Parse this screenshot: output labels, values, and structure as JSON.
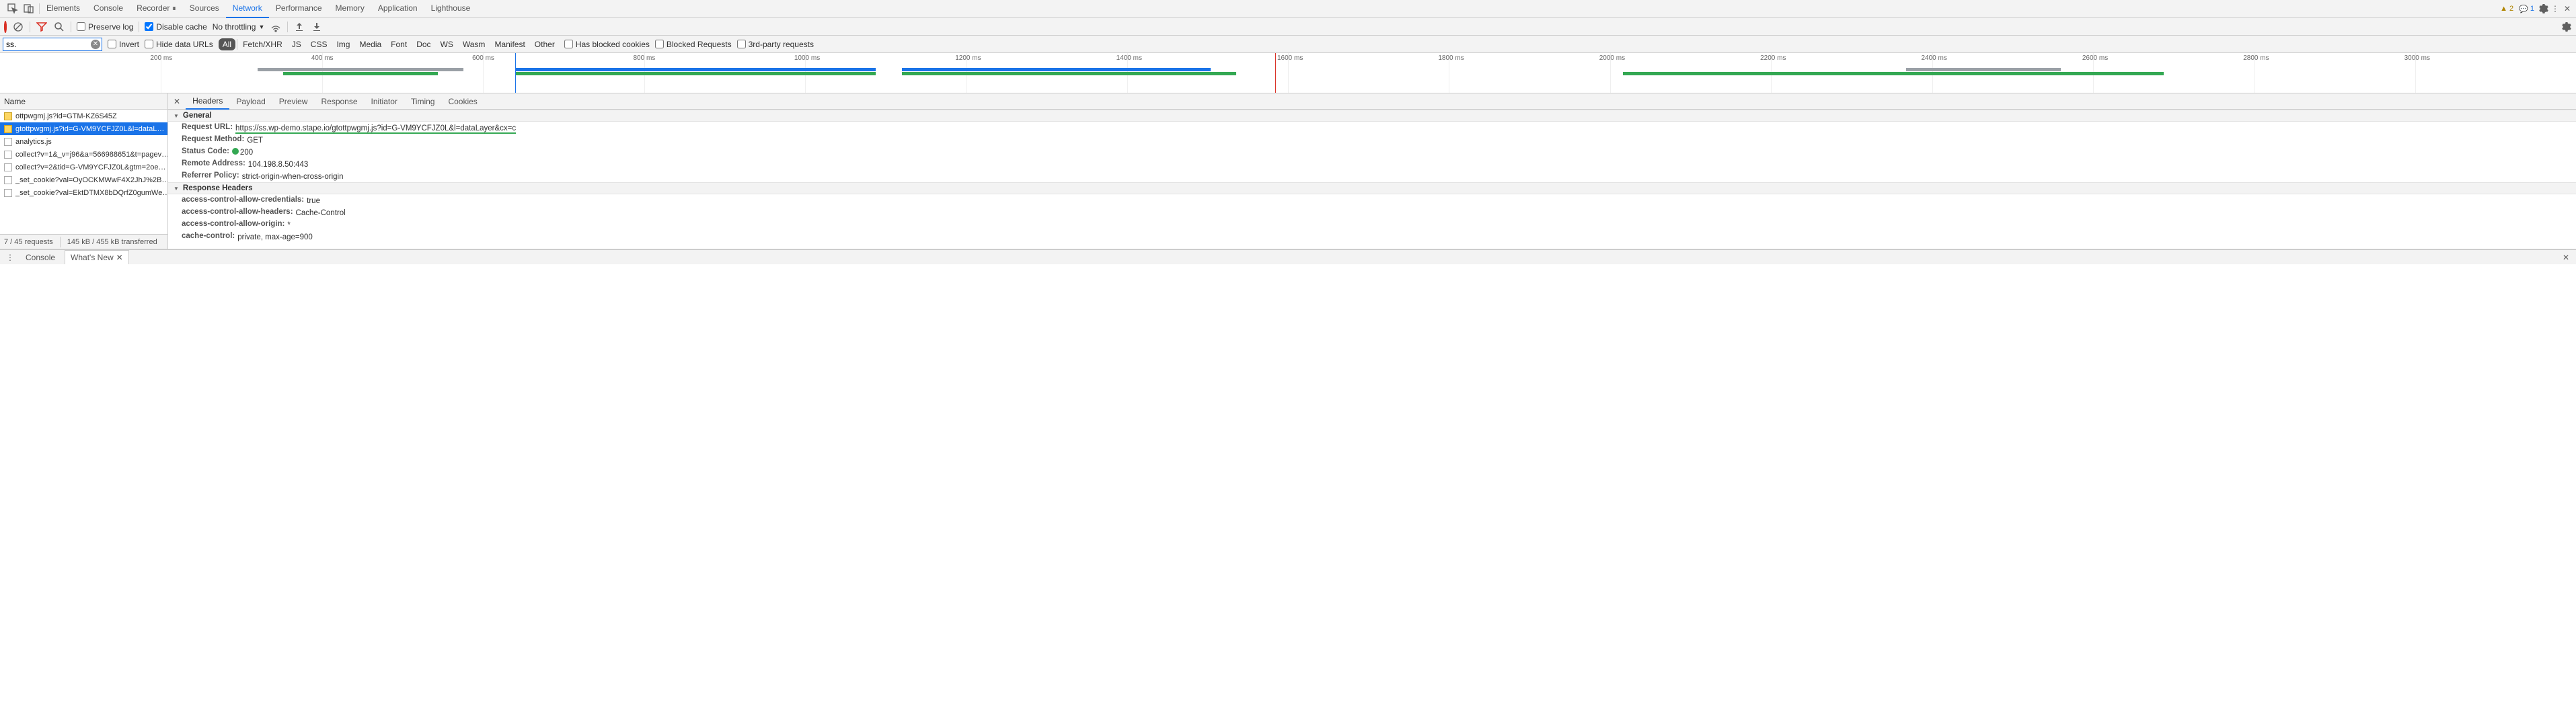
{
  "top": {
    "tabs": [
      "Elements",
      "Console",
      "Recorder ⏸",
      "Sources",
      "Network",
      "Performance",
      "Memory",
      "Application",
      "Lighthouse"
    ],
    "active": 4,
    "warnings": "2",
    "messages": "1"
  },
  "toolbar": {
    "preserve_log": "Preserve log",
    "disable_cache": "Disable cache",
    "throttling": "No throttling"
  },
  "filter": {
    "value": "ss.",
    "invert": "Invert",
    "hide_data": "Hide data URLs",
    "types": [
      "All",
      "Fetch/XHR",
      "JS",
      "CSS",
      "Img",
      "Media",
      "Font",
      "Doc",
      "WS",
      "Wasm",
      "Manifest",
      "Other"
    ],
    "active_type": 0,
    "blocked_cookies": "Has blocked cookies",
    "blocked_requests": "Blocked Requests",
    "third_party": "3rd-party requests"
  },
  "waterfall": {
    "ticks": [
      "200 ms",
      "400 ms",
      "600 ms",
      "800 ms",
      "1000 ms",
      "1200 ms",
      "1400 ms",
      "1600 ms",
      "1800 ms",
      "2000 ms",
      "2200 ms",
      "2400 ms",
      "2600 ms",
      "2800 ms",
      "3000 ms"
    ]
  },
  "requests": {
    "header": "Name",
    "items": [
      {
        "icon": "js",
        "label": "ottpwgmj.js?id=GTM-KZ6S45Z"
      },
      {
        "icon": "js",
        "label": "gtottpwgmj.js?id=G-VM9YCFJZ0L&l=dataL…"
      },
      {
        "icon": "doc",
        "label": "analytics.js"
      },
      {
        "icon": "doc",
        "label": "collect?v=1&_v=j96&a=566988651&t=pagev…"
      },
      {
        "icon": "doc",
        "label": "collect?v=2&tid=G-VM9YCFJZ0L&gtm=2oe…"
      },
      {
        "icon": "doc",
        "label": "_set_cookie?val=OyOCKMWwF4X2JhJ%2B…"
      },
      {
        "icon": "doc",
        "label": "_set_cookie?val=EktDTMX8bDQrfZ0gumWe…"
      }
    ],
    "selected": 1,
    "footer_left": "7 / 45 requests",
    "footer_right": "145 kB / 455 kB transferred"
  },
  "detail": {
    "tabs": [
      "Headers",
      "Payload",
      "Preview",
      "Response",
      "Initiator",
      "Timing",
      "Cookies"
    ],
    "active": 0,
    "general_title": "General",
    "general": [
      {
        "k": "Request URL:",
        "v": "https://ss.wp-demo.stape.io/gtottpwgmj.js?id=G-VM9YCFJZ0L&l=dataLayer&cx=c",
        "url": true
      },
      {
        "k": "Request Method:",
        "v": "GET"
      },
      {
        "k": "Status Code:",
        "v": "200",
        "status": true
      },
      {
        "k": "Remote Address:",
        "v": "104.198.8.50:443"
      },
      {
        "k": "Referrer Policy:",
        "v": "strict-origin-when-cross-origin"
      }
    ],
    "resp_title": "Response Headers",
    "resp": [
      {
        "k": "access-control-allow-credentials:",
        "v": "true"
      },
      {
        "k": "access-control-allow-headers:",
        "v": "Cache-Control"
      },
      {
        "k": "access-control-allow-origin:",
        "v": "*"
      },
      {
        "k": "cache-control:",
        "v": "private, max-age=900"
      }
    ]
  },
  "drawer": {
    "console": "Console",
    "whatsnew": "What's New"
  }
}
